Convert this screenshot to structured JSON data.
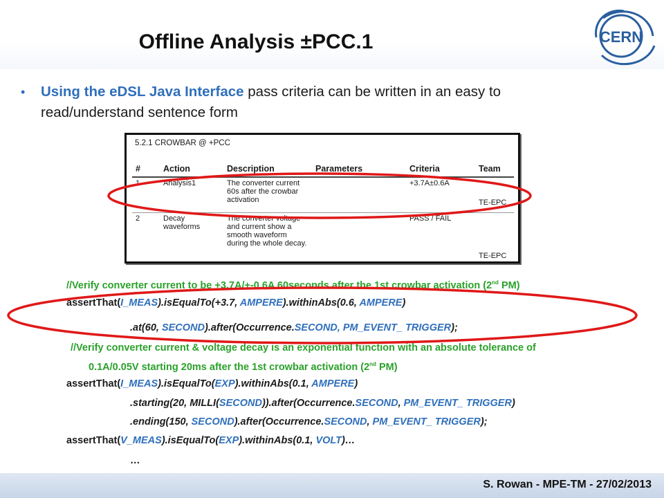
{
  "slide": {
    "title": "Offline Analysis ±PCC.1",
    "logo_text": "CERN",
    "bullet": {
      "highlight": "Using the eDSL Java Interface",
      "rest": " pass criteria can be written in an easy to read/understand sentence form"
    }
  },
  "spec_table": {
    "section": "5.2.1  CROWBAR @ +PCC",
    "headers": [
      "#",
      "Action",
      "Description",
      "Parameters",
      "Criteria",
      "Team"
    ],
    "rows": [
      {
        "num": "1",
        "action": "Analysis1",
        "description": "The converter current 60s after the crowbar activation",
        "parameters": "",
        "criteria": "+3.7A±0.6A",
        "team": "TE-EPC"
      },
      {
        "num": "2",
        "action": "Decay waveforms",
        "description": "The converter voltage and current show a smooth waveform during the whole decay.",
        "parameters": "",
        "criteria": "PASS / FAIL",
        "team": "TE-EPC"
      }
    ]
  },
  "code": {
    "c1a": "//Verify converter current to be +3.7A/+-0.6A 60seconds after the 1st crowbar activation (2",
    "c1b": "nd",
    "c1c": " PM)",
    "l2": [
      "assertThat(",
      "I_MEAS",
      ").isEqualTo(+3.7, ",
      "AMPERE",
      ").withinAbs(0.6, ",
      "AMPERE",
      ")"
    ],
    "l3": [
      ".at(60, ",
      "SECOND",
      ").after(Occurrence.",
      "SECOND, PM_EVENT_ TRIGGER",
      ");"
    ],
    "c4": "//Verify converter current & voltage decay is an exponential function with an absolute tolerance of",
    "c5a": "0.1A/0.05V  starting 20ms after the 1st crowbar activation (2",
    "c5b": "nd",
    "c5c": " PM)",
    "l6": [
      "assertThat(",
      "I_MEAS",
      ").isEqualTo(",
      "EXP",
      ").withinAbs(0.1, ",
      "AMPERE",
      ")"
    ],
    "l7": [
      ".starting(20, MILLI(",
      "SECOND",
      ")).after(Occurrence.",
      "SECOND",
      ", ",
      "PM_EVENT_ TRIGGER",
      ")"
    ],
    "l8": [
      ".ending(150, ",
      "SECOND",
      ").after(Occurrence.",
      "SECOND",
      ", ",
      "PM_EVENT_ TRIGGER",
      ");"
    ],
    "l9": [
      "assertThat(",
      "V_MEAS",
      ").isEqualTo(",
      "EXP",
      ").withinAbs(0.1, ",
      "VOLT",
      ")…"
    ],
    "l10": "…"
  },
  "footer": "S. Rowan - MPE-TM - 27/02/2013",
  "colors": {
    "highlight": "#2f6fbb",
    "comment": "#2aa12a",
    "ellipse": "#e01818",
    "footer_band": "#c7d5e8"
  }
}
